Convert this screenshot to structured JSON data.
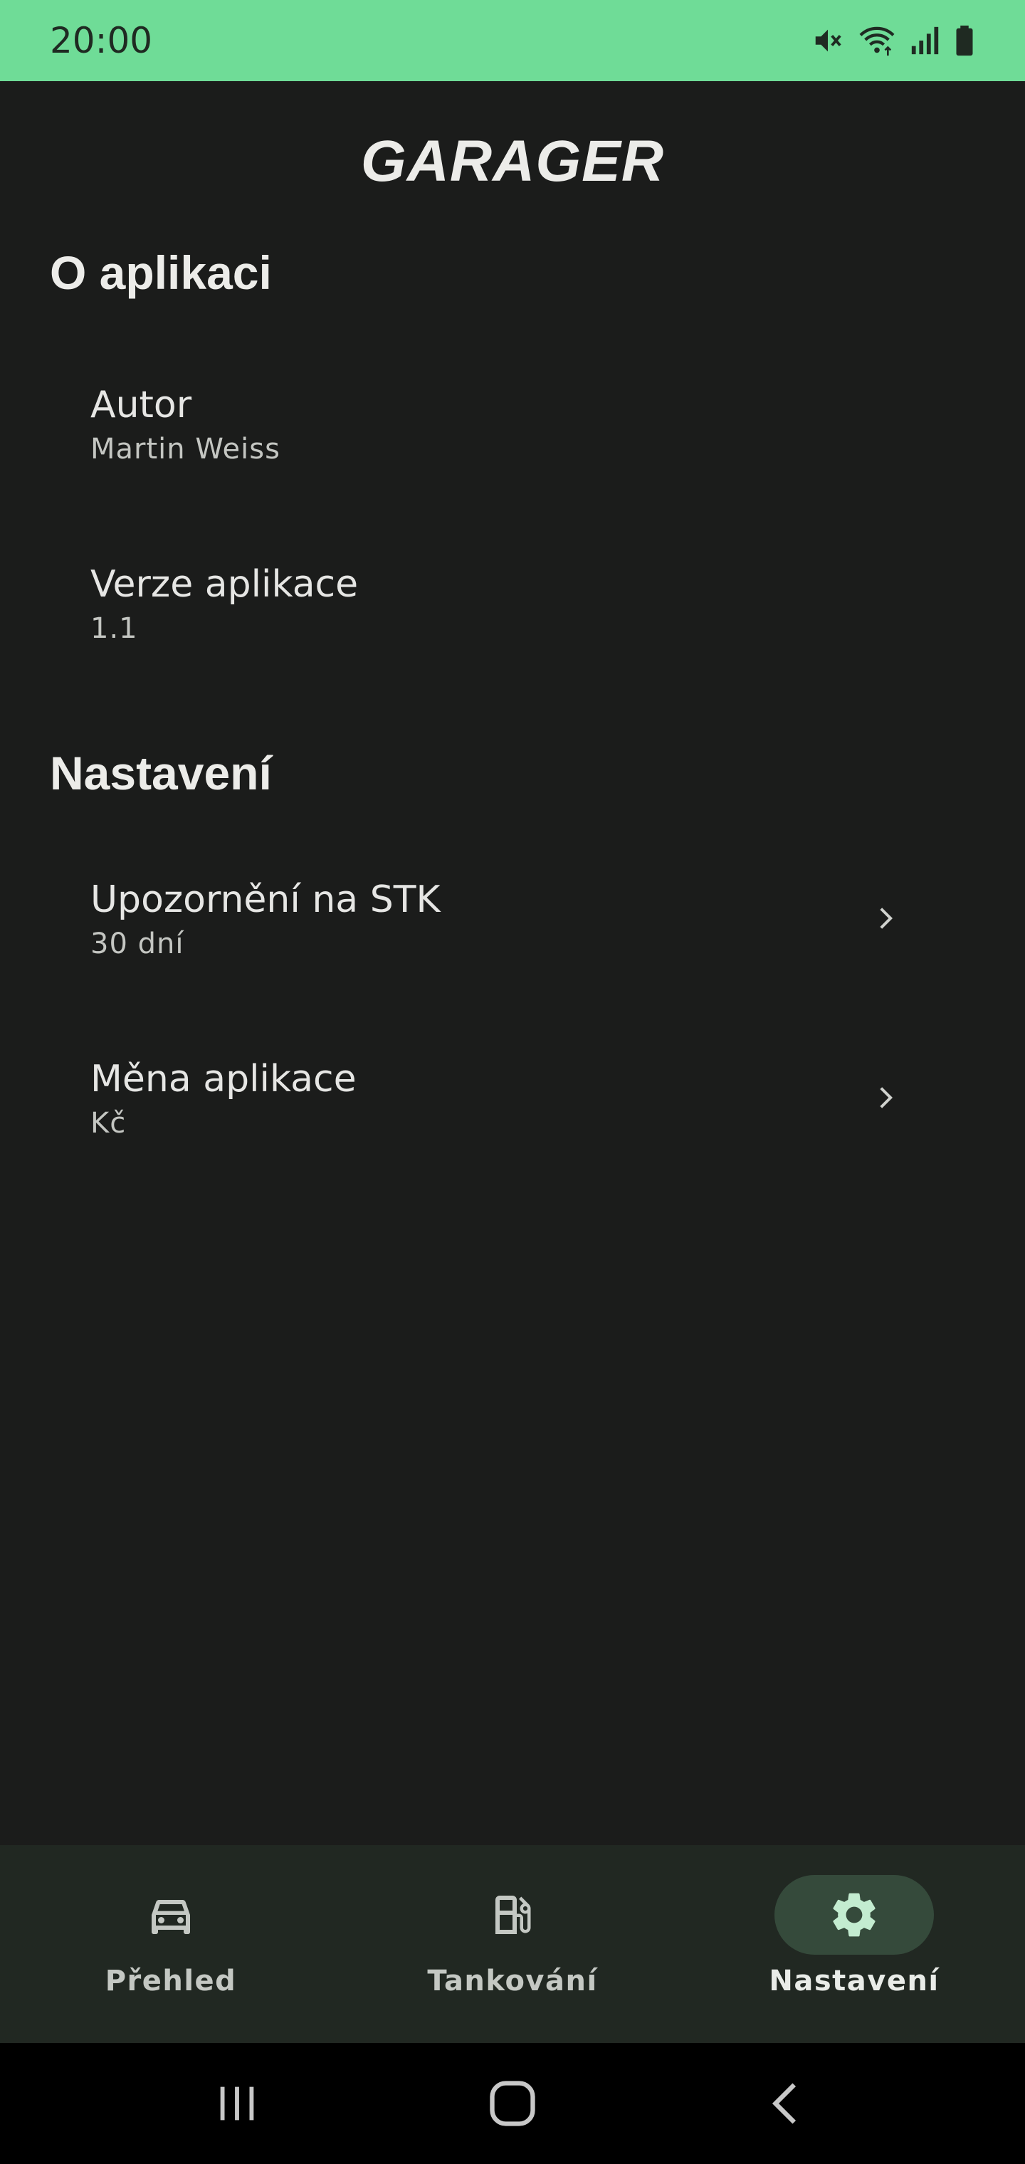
{
  "status_bar": {
    "time": "20:00",
    "icons": [
      "mute-icon",
      "wifi-icon",
      "signal-icon",
      "battery-icon"
    ]
  },
  "app": {
    "title": "GARAGER"
  },
  "sections": {
    "about": {
      "header": "O aplikaci",
      "items": [
        {
          "title": "Autor",
          "summary": "Martin Weiss"
        },
        {
          "title": "Verze aplikace",
          "summary": "1.1"
        }
      ]
    },
    "settings": {
      "header": "Nastavení",
      "items": [
        {
          "title": "Upozornění na STK",
          "summary": "30 dní"
        },
        {
          "title": "Měna aplikace",
          "summary": "Kč"
        }
      ]
    }
  },
  "bottom_nav": {
    "items": [
      {
        "label": "Přehled",
        "icon": "car-icon"
      },
      {
        "label": "Tankování",
        "icon": "fuel-pump-icon"
      },
      {
        "label": "Nastavení",
        "icon": "gear-icon",
        "active": true
      }
    ]
  },
  "system_nav": {
    "buttons": [
      "recents-icon",
      "home-icon",
      "back-icon"
    ]
  },
  "colors": {
    "status_bar": "#6fdc97",
    "background": "#1b1c1b",
    "bottom_nav": "#212822",
    "active_indicator": "#354a3b"
  }
}
